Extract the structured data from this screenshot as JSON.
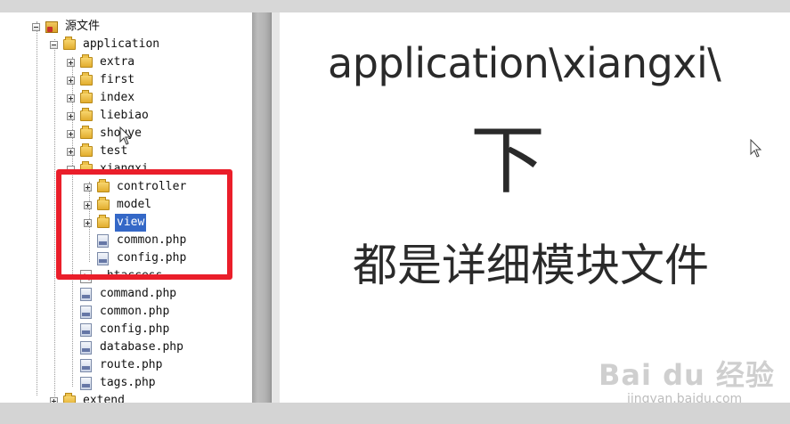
{
  "tree": {
    "root": "源文件",
    "application": "application",
    "folders": [
      "extra",
      "first",
      "index",
      "liebiao",
      "shouye",
      "test"
    ],
    "xiangxi": {
      "label": "xiangxi",
      "children": [
        "controller",
        "model",
        "view"
      ],
      "files": [
        "common.php",
        "config.php"
      ],
      "selected": "view"
    },
    "app_files": [
      ".htaccess",
      "command.php",
      "common.php",
      "config.php",
      "database.php",
      "route.php",
      "tags.php"
    ],
    "last_partial": "extend"
  },
  "caption": {
    "line1": "application\\xiangxi\\",
    "line2": "下",
    "line3": "都是详细模块文件"
  },
  "watermark": {
    "logo": "Bai du 经验",
    "sub": "jingyan.baidu.com"
  },
  "colors": {
    "highlight": "#ea1e2a",
    "selection": "#3468c7",
    "folder": "#e8b838"
  }
}
